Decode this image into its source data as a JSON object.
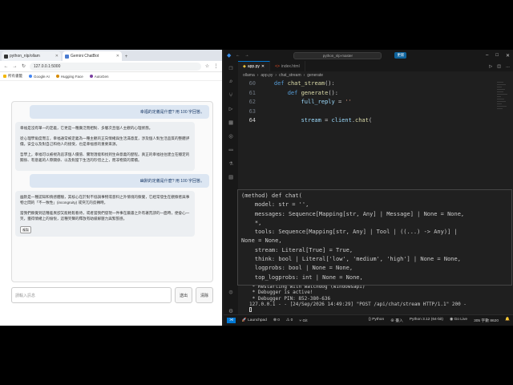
{
  "browser": {
    "tabs": [
      {
        "label": "python_nlp/ollam",
        "active": false
      },
      {
        "label": "Gemini ChatBot",
        "active": true
      }
    ],
    "url": "127.0.0.1:5000",
    "bookmarks": [
      "所有書籤",
      "Google AI",
      "Hugging Face",
      "AutoGen"
    ]
  },
  "chat": {
    "messages": [
      {
        "role": "user",
        "text": "幸福的定義是什麼? 用 100 字回答。"
      },
      {
        "role": "bot",
        "paragraphs": [
          "幸福是沒有單一的定義，它更是一種廣泛而相對、多層次且個人主觀的心理狀態。",
          "從心理學角度而言，幸福通常被定義為一種主觀的正向情緒與生活滿意度，涉及個人對生活品質的整體評價。安全以及對自己和他人的接受，也是幸福感的重要來源。",
          "哲學上，幸福可以被視為追求個人價值、實現潛能和找到生命意義的歷程。真正的幸福往往建立在穩定的關係、有意義的人際關係、以及對當下生活的珍惜之上，而非物質的累積。"
        ]
      },
      {
        "role": "user",
        "text": "幽默的定義是什麼? 用 100 字回答。"
      },
      {
        "role": "bot",
        "paragraphs": [
          "幽默是一種認知和情感體驗，其核心在於對不協調事物或意料之外情境的察覺，它經常發生在觀察者與事物之間的「不一致性」(incongruity) 或突兀的反轉時。",
          "當我們察覺到這種差異卻又能輕鬆看待，或者當我們發現一件事在嚴肅之外有著荒謬的一面時，便會心一笑，獲得情緒上的愉悅，這種笑聲的釋放有助緩解壓力與緊張感。"
        ],
        "copy_label": "複製"
      }
    ],
    "input_placeholder": "請輸入訊息",
    "send_label": "送出",
    "clear_label": "清除"
  },
  "vscode": {
    "search_text": "python_nlp-master",
    "update_label": "更新",
    "tabs": [
      {
        "label": "app.py",
        "kind": "py",
        "active": true
      },
      {
        "label": "index.html",
        "kind": "html",
        "active": false
      }
    ],
    "breadcrumb": [
      "ollama",
      "app.py",
      "chat_stream",
      "generate"
    ],
    "code_lines": [
      {
        "n": "60",
        "segments": [
          {
            "c": "pl",
            "t": "    "
          },
          {
            "c": "kw",
            "t": "def"
          },
          {
            "c": "pl",
            "t": " "
          },
          {
            "c": "fn",
            "t": "chat_stream"
          },
          {
            "c": "pl",
            "t": "():"
          }
        ]
      },
      {
        "n": "61",
        "segments": [
          {
            "c": "pl",
            "t": "        "
          },
          {
            "c": "kw",
            "t": "def"
          },
          {
            "c": "pl",
            "t": " "
          },
          {
            "c": "fn",
            "t": "generate"
          },
          {
            "c": "pl",
            "t": "():"
          }
        ]
      },
      {
        "n": "62",
        "segments": [
          {
            "c": "pl",
            "t": "            "
          },
          {
            "c": "vr",
            "t": "full_reply"
          },
          {
            "c": "pl",
            "t": " = "
          },
          {
            "c": "st",
            "t": "''"
          }
        ]
      },
      {
        "n": "63",
        "segments": [
          {
            "c": "pl",
            "t": ""
          }
        ]
      },
      {
        "n": "64",
        "segments": [
          {
            "c": "pl",
            "t": "            "
          },
          {
            "c": "vr",
            "t": "stream"
          },
          {
            "c": "pl",
            "t": " = "
          },
          {
            "c": "vr",
            "t": "client"
          },
          {
            "c": "pl",
            "t": "."
          },
          {
            "c": "fn",
            "t": "chat"
          },
          {
            "c": "pl",
            "t": "("
          }
        ]
      }
    ],
    "hover_lines": [
      "(method) def chat(",
      "    model: str = '',",
      "    messages: Sequence[Mapping[str, Any] | Message] | None = None,",
      "    *,",
      "    tools: Sequence[Mapping[str, Any] | Tool | ((...) -> Any)] |",
      "None = None,",
      "    stream: Literal[True] = True,",
      "    think: bool | Literal['low', 'medium', 'high'] | None = None,",
      "    logprobs: bool | None = None,",
      "    top_logprobs: int | None = None,"
    ],
    "terminal_lines": [
      " * Restarting with watchdog (windowsapi)",
      " * Debugger is active!",
      " * Debugger PIN: 852-380-636",
      "127.0.0.1 - - [24/Sep/2026 14:49:29] \"POST /api/chat/stream HTTP/1.1\" 200 -"
    ],
    "status_left": [
      "Launchpad",
      "0",
      "0",
      "Git"
    ],
    "status_right": [
      "Python",
      "⊕ 臺入",
      "Python 3.12 (64-bit)",
      "Go Live",
      "305 字數 8620"
    ]
  },
  "taskbar": {
    "items": [
      {
        "label": "3D 軟件",
        "color": "#3a7bd5"
      },
      {
        "label": "OBS 32.1.2 -...",
        "color": "#222222"
      },
      {
        "label": "",
        "color": "#f0a500"
      },
      {
        "label": "",
        "color": "#c2185b"
      },
      {
        "label": "",
        "color": "#2e7d32"
      },
      {
        "label": "app.py - pyt...",
        "color": "#0078d4",
        "active": true
      },
      {
        "label": "",
        "color": "#5c2d91"
      },
      {
        "label": "Calendar | C...",
        "color": "#7b1fa2"
      },
      {
        "label": "Python 程式...",
        "color": "#5e35b1"
      },
      {
        "label": "AI 模擬程式...",
        "color": "#1565c0"
      },
      {
        "label": "會議紀錄的...",
        "color": "#4527a0"
      },
      {
        "label": "Gemini Chat...",
        "color": "#e53935"
      }
    ],
    "time": "下午 02:49",
    "date": "2026/9/24"
  }
}
